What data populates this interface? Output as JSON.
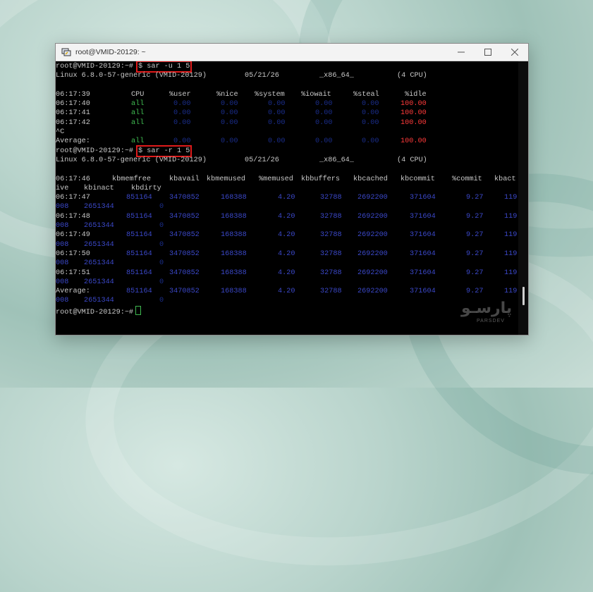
{
  "window": {
    "title": "root@VMID-20129: ~"
  },
  "session": {
    "prompt": "root@VMID-20129:~#",
    "cmd1": "$ sar -u 1 5",
    "cmd2": "$ sar -r 1 5",
    "sysinfo": {
      "os": "Linux 6.8.0-57-generic (VMID-20129)",
      "date": "05/21/26",
      "arch": "_x86_64_",
      "cpus": "(4 CPU)"
    }
  },
  "cpu": {
    "header": {
      "time": "06:17:39",
      "cols": [
        "CPU",
        "%user",
        "%nice",
        "%system",
        "%iowait",
        "%steal",
        "%idle"
      ]
    },
    "rows": [
      {
        "time": "06:17:40",
        "cpu": "all",
        "user": "0.00",
        "nice": "0.00",
        "system": "0.00",
        "iowait": "0.00",
        "steal": "0.00",
        "idle": "100.00"
      },
      {
        "time": "06:17:41",
        "cpu": "all",
        "user": "0.00",
        "nice": "0.00",
        "system": "0.00",
        "iowait": "0.00",
        "steal": "0.00",
        "idle": "100.00"
      },
      {
        "time": "06:17:42",
        "cpu": "all",
        "user": "0.00",
        "nice": "0.00",
        "system": "0.00",
        "iowait": "0.00",
        "steal": "0.00",
        "idle": "100.00"
      }
    ],
    "interrupt": "^C",
    "average": {
      "label": "Average:",
      "cpu": "all",
      "user": "0.00",
      "nice": "0.00",
      "system": "0.00",
      "iowait": "0.00",
      "steal": "0.00",
      "idle": "100.00"
    }
  },
  "mem": {
    "header": {
      "time": "06:17:46",
      "cols": [
        "kbmemfree",
        "kbavail",
        "kbmemused",
        "%memused",
        "kbbuffers",
        "kbcached",
        "kbcommit",
        "%commit",
        "kbact"
      ],
      "wrap_cols": [
        "ive",
        "kbinact",
        "kbdirty"
      ]
    },
    "rows": [
      {
        "time": "06:17:47",
        "v": [
          "851164",
          "3470852",
          "168388",
          "4.20",
          "32788",
          "2692200",
          "371604",
          "9.27",
          "119"
        ],
        "w": [
          "008",
          "2651344",
          "0"
        ]
      },
      {
        "time": "06:17:48",
        "v": [
          "851164",
          "3470852",
          "168388",
          "4.20",
          "32788",
          "2692200",
          "371604",
          "9.27",
          "119"
        ],
        "w": [
          "008",
          "2651344",
          "0"
        ]
      },
      {
        "time": "06:17:49",
        "v": [
          "851164",
          "3470852",
          "168388",
          "4.20",
          "32788",
          "2692200",
          "371604",
          "9.27",
          "119"
        ],
        "w": [
          "008",
          "2651344",
          "0"
        ]
      },
      {
        "time": "06:17:50",
        "v": [
          "851164",
          "3470852",
          "168388",
          "4.20",
          "32788",
          "2692200",
          "371604",
          "9.27",
          "119"
        ],
        "w": [
          "008",
          "2651344",
          "0"
        ]
      },
      {
        "time": "06:17:51",
        "v": [
          "851164",
          "3470852",
          "168388",
          "4.20",
          "32788",
          "2692200",
          "371604",
          "9.27",
          "119"
        ],
        "w": [
          "008",
          "2651344",
          "0"
        ]
      }
    ],
    "average": {
      "label": "Average:",
      "v": [
        "851164",
        "3470852",
        "168388",
        "4.20",
        "32788",
        "2692200",
        "371604",
        "9.27",
        "119"
      ],
      "w": [
        "008",
        "2651344",
        "0"
      ]
    }
  },
  "watermark": {
    "text": "پارسـو",
    "sub": "PARSDEV"
  },
  "colors": {
    "accent_green": "#3fb950",
    "value_blue": "#3b48c8",
    "idle_red": "#ff3a3a",
    "highlight": "#e01b1b"
  }
}
